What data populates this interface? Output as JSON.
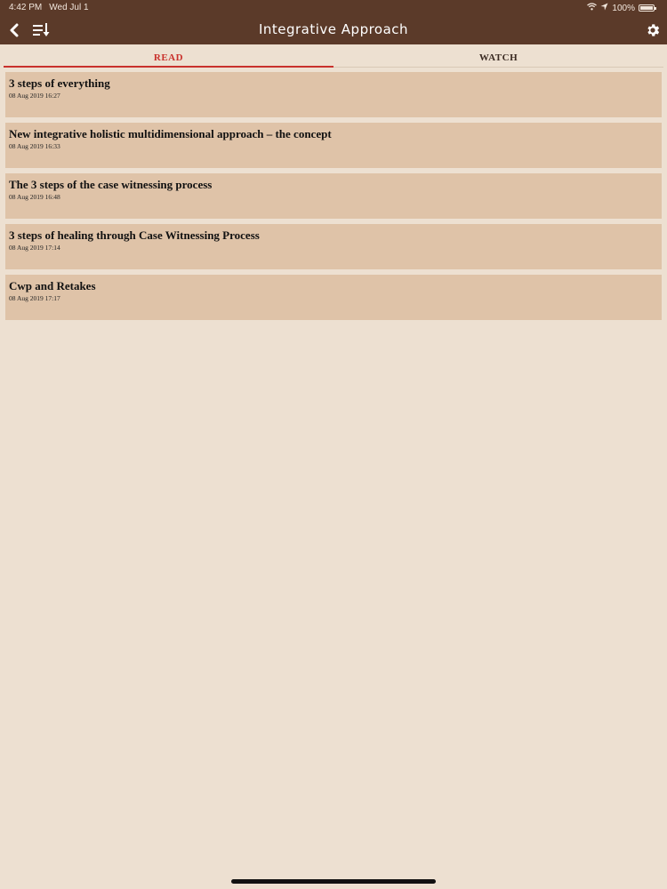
{
  "status_bar": {
    "time": "4:42 PM",
    "date": "Wed Jul 1",
    "battery": "100%"
  },
  "nav": {
    "title": "Integrative Approach",
    "icons": {
      "back": "chevron-left-icon",
      "sort": "sort-icon",
      "settings": "gear-icon"
    }
  },
  "tabs": [
    {
      "label": "READ",
      "active": true
    },
    {
      "label": "WATCH",
      "active": false
    }
  ],
  "articles": [
    {
      "title": "3 steps of everything",
      "date": "08 Aug 2019 16:27"
    },
    {
      "title": "New integrative holistic multidimensional approach – the concept",
      "date": "08 Aug 2019 16:33"
    },
    {
      "title": "The 3 steps of the case witnessing process",
      "date": "08 Aug 2019 16:48"
    },
    {
      "title": "3 steps of healing through Case Witnessing Process",
      "date": "08 Aug 2019 17:14"
    },
    {
      "title": "Cwp and Retakes",
      "date": "08 Aug 2019 17:17"
    }
  ],
  "colors": {
    "header": "#5b3a29",
    "background": "#ede0d1",
    "card": "#dfc3a8",
    "active_tab": "#c9312c"
  }
}
